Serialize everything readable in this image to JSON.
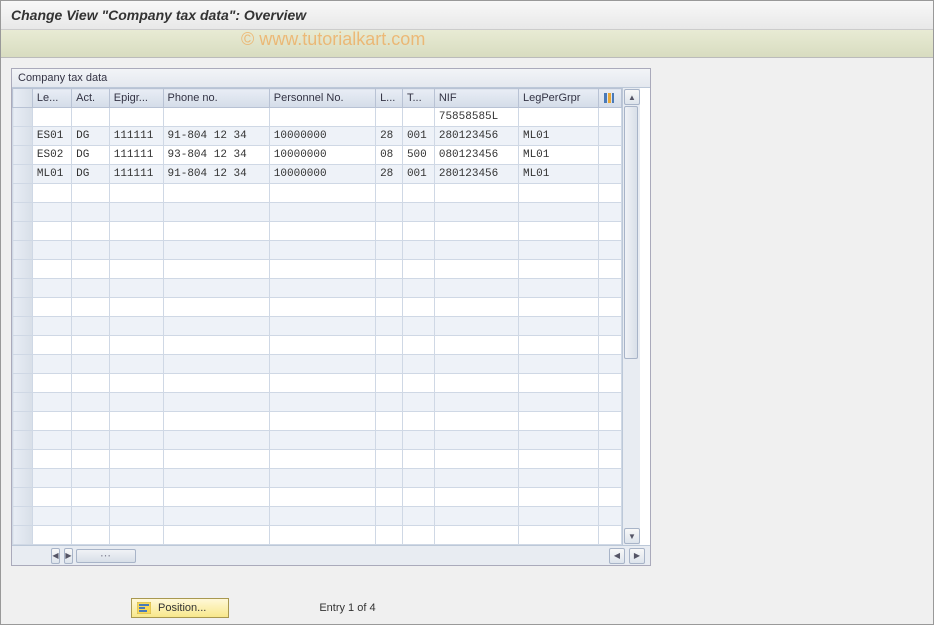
{
  "title": "Change View \"Company tax data\": Overview",
  "watermark": "© www.tutorialkart.com",
  "table": {
    "caption": "Company tax data",
    "headers": {
      "le": "Le...",
      "act": "Act.",
      "epigr": "Epigr...",
      "phone": "Phone no.",
      "personnel": "Personnel No.",
      "l": "L...",
      "t": "T...",
      "nif": "NIF",
      "legper": "LegPerGrpr"
    },
    "rows": [
      {
        "le": "",
        "act": "",
        "epigr": "",
        "phone": "",
        "personnel": "",
        "l": "",
        "t": "",
        "nif": "75858585L",
        "legper": ""
      },
      {
        "le": "ES01",
        "act": "DG",
        "epigr": "111111",
        "phone": "91-804 12 34",
        "personnel": "10000000",
        "l": "28",
        "t": "001",
        "nif": "280123456",
        "legper": "ML01"
      },
      {
        "le": "ES02",
        "act": "DG",
        "epigr": "111111",
        "phone": "93-804 12 34",
        "personnel": "10000000",
        "l": "08",
        "t": "500",
        "nif": "080123456",
        "legper": "ML01"
      },
      {
        "le": "ML01",
        "act": "DG",
        "epigr": "111111",
        "phone": "91-804 12 34",
        "personnel": "10000000",
        "l": "28",
        "t": "001",
        "nif": "280123456",
        "legper": "ML01"
      }
    ]
  },
  "footer": {
    "position_label": "Position...",
    "entry_text": "Entry 1 of 4"
  }
}
